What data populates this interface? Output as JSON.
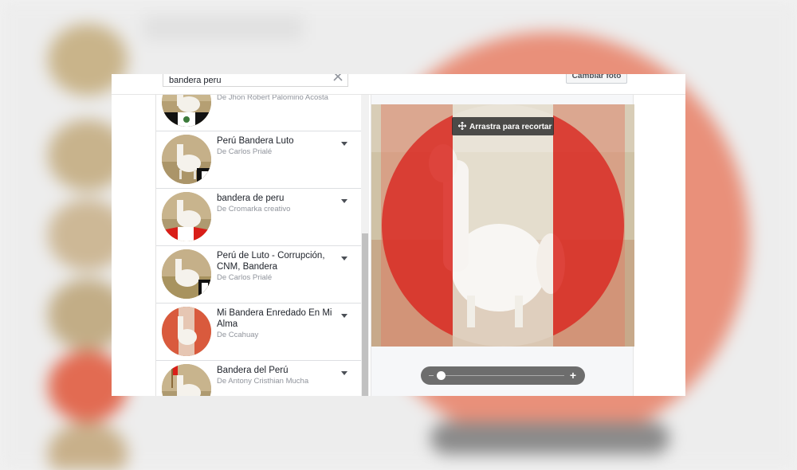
{
  "search": {
    "value": "bandera peru"
  },
  "header": {
    "change_photo_label": "Cambiar foto"
  },
  "crop": {
    "drag_label": "Arrastra para recortar",
    "zoom_level": 0.0
  },
  "frames": [
    {
      "title": "",
      "author": "De Jhon Robert Palomino Acosta"
    },
    {
      "title": "Perú Bandera Luto",
      "author": "De Carlos Prialé"
    },
    {
      "title": "bandera de peru",
      "author": "De Cromarka creativo"
    },
    {
      "title": "Perú de Luto - Corrupción, CNM, Bandera",
      "author": "De Carlos Prialé"
    },
    {
      "title": "Mi Bandera Enredado En Mi Alma",
      "author": "De Ccahuay"
    },
    {
      "title": "Bandera del Perú",
      "author": "De Antony Cristhian Mucha"
    }
  ],
  "colors": {
    "flag_red": "#d91e18",
    "border": "#dddfe2",
    "text_secondary": "#90949c"
  }
}
